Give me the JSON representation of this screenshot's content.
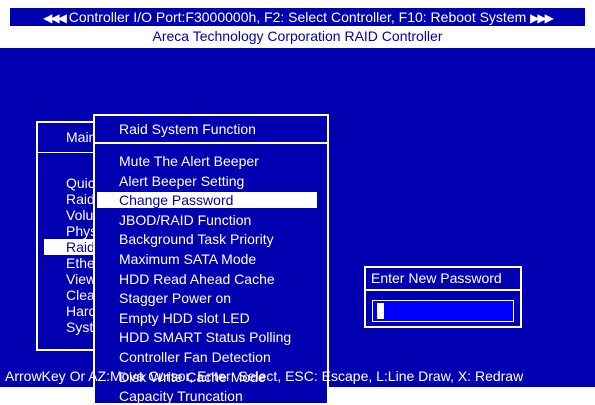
{
  "header": {
    "left_arrows": "◀◀◀",
    "status_line": "Controller I/O Port:F3000000h, F2: Select Controller, F10: Reboot System",
    "right_arrows": "▶▶▶",
    "subtitle": "Areca Technology Corporation RAID Controller"
  },
  "main_menu": {
    "title": "Main",
    "items": [
      {
        "label": "Quick"
      },
      {
        "label": "Raid"
      },
      {
        "label": "Volume"
      },
      {
        "label": "Physical"
      },
      {
        "label": "Raid"
      },
      {
        "label": "Ethernet"
      },
      {
        "label": "View"
      },
      {
        "label": "Clear"
      },
      {
        "label": "Hardware"
      },
      {
        "label": "System"
      }
    ],
    "selected_index": 4
  },
  "sub_menu": {
    "title": "Raid System Function",
    "items": [
      {
        "label": "Mute The Alert Beeper"
      },
      {
        "label": "Alert Beeper Setting"
      },
      {
        "label": "Change Password"
      },
      {
        "label": "JBOD/RAID Function"
      },
      {
        "label": "Background Task Priority"
      },
      {
        "label": "Maximum SATA Mode"
      },
      {
        "label": "HDD Read Ahead Cache"
      },
      {
        "label": "Stagger Power on"
      },
      {
        "label": "Empty HDD slot LED"
      },
      {
        "label": "HDD SMART Status Polling"
      },
      {
        "label": "Controller Fan Detection"
      },
      {
        "label": "Disk Write Cache Mode"
      },
      {
        "label": "Capacity Truncation"
      }
    ],
    "selected_index": 2
  },
  "password_dialog": {
    "title": "Enter New Password",
    "value": ""
  },
  "footer": {
    "help_text": "ArrowKey Or AZ:Move Cursor, Enter: Select, ESC: Escape, L:Line Draw, X: Redraw"
  },
  "colors": {
    "background": "#0000b0",
    "foreground": "#ffffff",
    "input_fill": "#0000ff"
  }
}
